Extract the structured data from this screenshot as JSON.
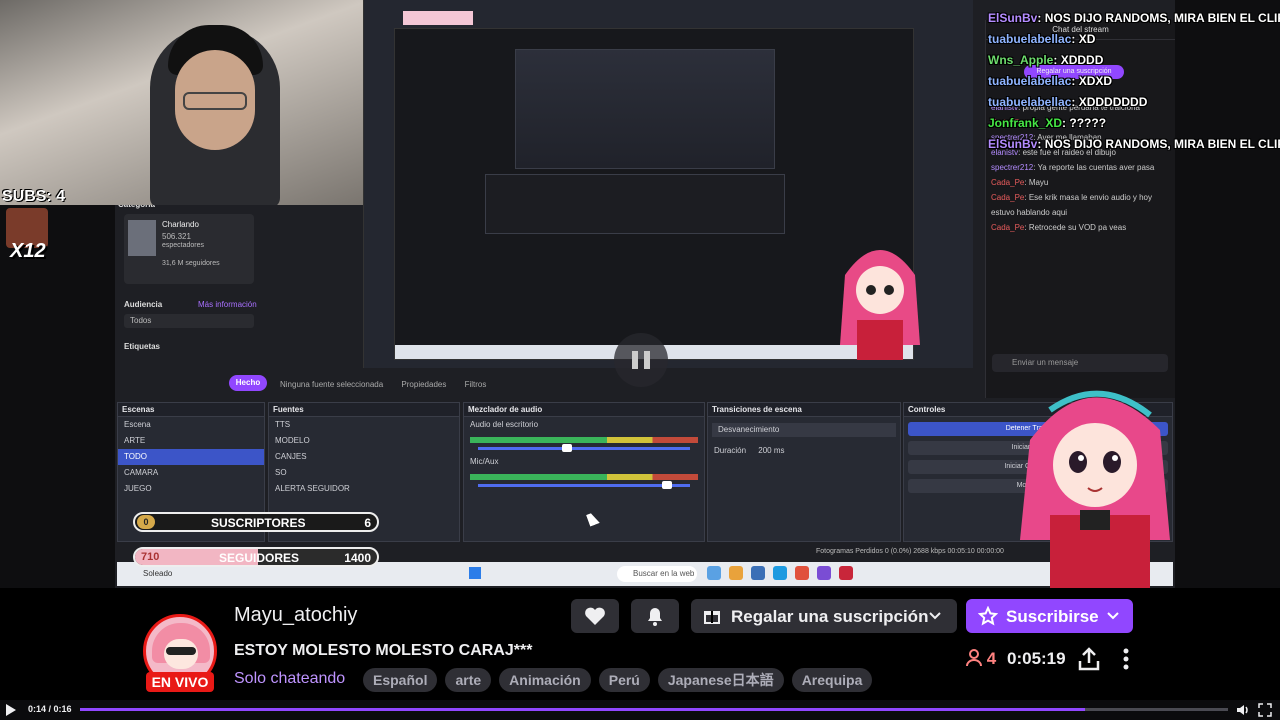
{
  "overlay": {
    "subs_label": "SUBS: 4",
    "subs_multiplier": "X12",
    "goal_subs": {
      "badge": "0",
      "label": "SUSCRIPTORES",
      "value": "6"
    },
    "goal_followers": {
      "current": "710",
      "label": "SEGUIDORES",
      "value": "1400",
      "progress": 0.51
    }
  },
  "chat_overlay": [
    {
      "user": "ElSunBv",
      "text": "NOS DIJO RANDOMS, MIRA BIEN EL CLIP",
      "color": "#b48cff"
    },
    {
      "user": "tuabuelabellac",
      "text": "XD",
      "color": "#8fb4ff"
    },
    {
      "user": "Wns_Apple",
      "text": "XDDDD",
      "color": "#6ddc6d"
    },
    {
      "user": "tuabuelabellac",
      "text": "XDXD",
      "color": "#8fb4ff"
    },
    {
      "user": "tuabuelabellac",
      "text": "XDDDDDDD",
      "color": "#8fb4ff"
    },
    {
      "user": "Jonfrank_XD",
      "text": "?????",
      "color": "#46e846"
    },
    {
      "user": "ElSunBv",
      "text": "NOS DIJO RANDOMS, MIRA BIEN EL CLIP",
      "color": "#b48cff"
    }
  ],
  "obs": {
    "category_title": "Categoría",
    "category_name": "Charlando",
    "category_viewers": "506.321",
    "category_viewers_label": "espectadores",
    "category_followers": "31,6 M seguidores",
    "audience_label": "Audiencia",
    "more_info": "Más información",
    "audience_value": "Todos",
    "tags_label": "Etiquetas",
    "done_button": "Hecho",
    "source_bar": [
      "Ninguna fuente seleccionada",
      "Propiedades",
      "Filtros"
    ],
    "scenes_header": "Escenas",
    "scenes": [
      "Escena",
      "ARTE",
      "TODO",
      "CAMARA",
      "JUEGO"
    ],
    "sources_header": "Fuentes",
    "sources": [
      "TTS",
      "MODELO",
      "CANJES",
      "SO",
      "ALERTA SEGUIDOR"
    ],
    "mixer_header": "Mezclador de audio",
    "mixer_tracks": [
      "Audio del escritorio",
      "Mic/Aux"
    ],
    "transitions_header": "Transiciones de escena",
    "transition_value": "Desvanecimiento",
    "duration_label": "Duración",
    "duration_value": "200 ms",
    "controls_header": "Controles",
    "controls": [
      "Detener Transmisión",
      "Iniciar Grabación",
      "Iniciar Cámara Virtual",
      "Modo Estudio"
    ],
    "status": "Fotogramas Perdidos 0 (0.0%)   2688 kbps   00:05:10   00:00:00",
    "taskbar_weather": "Soleado",
    "taskbar_search": "Buscar en la web"
  },
  "chat_panel": {
    "header": "Chat del stream",
    "promo": "Regalar una suscripción",
    "input_placeholder": "Enviar un mensaje",
    "messages": [
      {
        "user": "elanistv",
        "text": "propia gente peruana te traiciona"
      },
      {
        "user": "Cada_Pe",
        "text": ""
      },
      {
        "user": "spectrer212",
        "text": "Aver me llamaban"
      },
      {
        "user": "elanistv",
        "text": "este fue el raideo el dibujo"
      },
      {
        "user": "spectrer212",
        "text": "Ya reporte las cuentas aver pasa"
      },
      {
        "user": "Cada_Pe",
        "text": "Mayu"
      },
      {
        "user": "Cada_Pe",
        "text": "Ese krik masa le envio audio y hoy estuvo hablando aqui"
      },
      {
        "user": "Cada_Pe",
        "text": "Retrocede su VOD pa veas"
      }
    ]
  },
  "channel": {
    "name": "Mayu_atochiy",
    "title": "ESTOY MOLESTO MOLESTO CARAJ***",
    "category": "Solo chateando",
    "live_badge": "EN VIVO",
    "tags": [
      "Español",
      "arte",
      "Animación",
      "Perú",
      "Japanese日本語",
      "Arequipa"
    ],
    "gift_label": "Regalar una suscripción",
    "subscribe_label": "Suscribirse",
    "viewers": "4",
    "uptime": "0:05:19"
  },
  "player": {
    "time": "0:14 / 0:16",
    "progress": 0.875
  },
  "colors": {
    "accent": "#9147ff",
    "live": "#e91916",
    "background": "#000000"
  }
}
